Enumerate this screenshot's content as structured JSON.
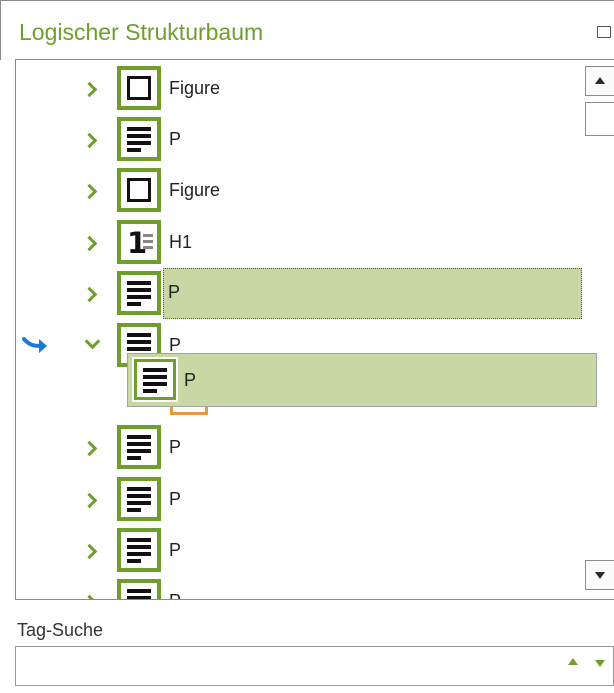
{
  "panel": {
    "title": "Logischer Strukturbaum"
  },
  "tree": {
    "rows": [
      {
        "label": "Figure",
        "expanded": false
      },
      {
        "label": "P",
        "expanded": false
      },
      {
        "label": "Figure",
        "expanded": false
      },
      {
        "label": "H1",
        "expanded": false
      },
      {
        "label": "P",
        "expanded": false,
        "selected": true
      },
      {
        "label": "P",
        "expanded": true
      },
      {
        "label": "P",
        "expanded": false
      },
      {
        "label": "P",
        "expanded": false
      },
      {
        "label": "P",
        "expanded": false
      },
      {
        "label": "P",
        "expanded": false
      }
    ],
    "drag_ghost_label": "P"
  },
  "search": {
    "label": "Tag-Suche",
    "value": "",
    "placeholder": ""
  },
  "icons": {
    "expand": "chevron-right-icon",
    "collapse": "chevron-down-icon",
    "figure": "figure-square-icon",
    "paragraph": "paragraph-lines-icon",
    "heading": "heading-one-icon",
    "drop": "drop-arrow-icon",
    "scroll_up": "scroll-up-icon",
    "scroll_down": "scroll-down-icon",
    "spin_up": "spin-up-icon",
    "spin_down": "spin-down-icon"
  },
  "colors": {
    "accent_green": "#6f9e2d",
    "selection_bg": "#c7d8a5",
    "drop_arrow": "#1d79d4",
    "drop_target": "#e99a3f"
  }
}
